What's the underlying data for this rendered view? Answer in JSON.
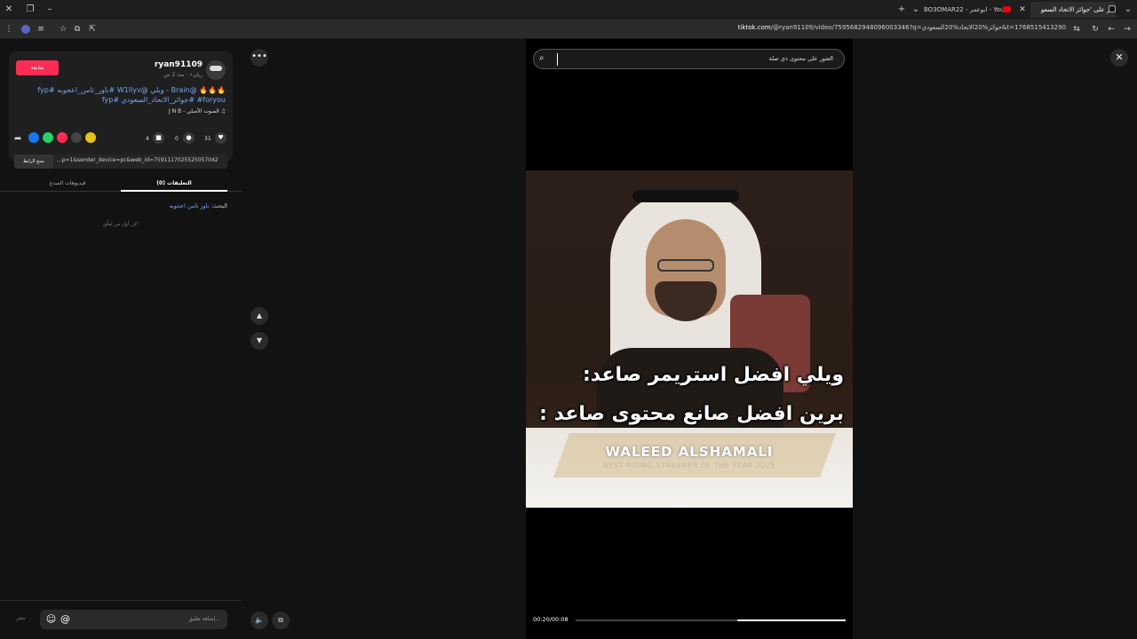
{
  "browser": {
    "tabs": [
      {
        "title": "انظر على 'جوائز الاتحاد السعو",
        "active": true
      },
      {
        "title": "BO3OMAR22 - ابوعمر - YouTube",
        "active": false
      }
    ],
    "url_host": "tiktok.com",
    "url_path": "/@ryan91109/video/7595682948096003346?q=جوائز%20الاتحاد%20السعودي&t=1768515413290"
  },
  "post": {
    "username": "ryan91109",
    "meta": "ريان⚡ · منذ 2 س",
    "follow_label": "متابعة",
    "description": "🔥🔥🔥 @Brain - ويلي @W1llyv #باور_ثامن_اعجوبه #fyp #foryou #جوائز_الاتحاد_السعودي #fyp",
    "sound": "الصوت الأصلي - J N B",
    "likes": "31",
    "comments": "0",
    "saves": "4",
    "link_text": "...p=1&sender_device=pc&web_id=7591117025525057042",
    "copy_label": "نسخ الرابط"
  },
  "comment_tabs": [
    {
      "label": "التعليقات (0)",
      "active": true
    },
    {
      "label": "فيديوهات المبدع",
      "active": false
    }
  ],
  "search_note_prefix": "البحث:",
  "search_note_query": "باور ثامن اعجوبه",
  "empty_note": "كن أول من يُعلِّق!",
  "comment_input": {
    "placeholder": "إضافة تعليق...",
    "post_label": "نشر"
  },
  "video": {
    "search_placeholder": "العثور على محتوى ذي صلة",
    "caption_line1": "ويلي افضل استريمر صاعد:",
    "caption_line2": "برين افضل صانع محتوى صاعد :",
    "plate_name": "WALEED ALSHAMALI",
    "plate_sub": "BEST RISING STREAMER OF THE YEAR 2025",
    "time": "00:20/00:08",
    "progress_fraction": 0.4
  },
  "colors": {
    "accent": "#fe2c55",
    "hashtag": "#6fa8ff"
  }
}
